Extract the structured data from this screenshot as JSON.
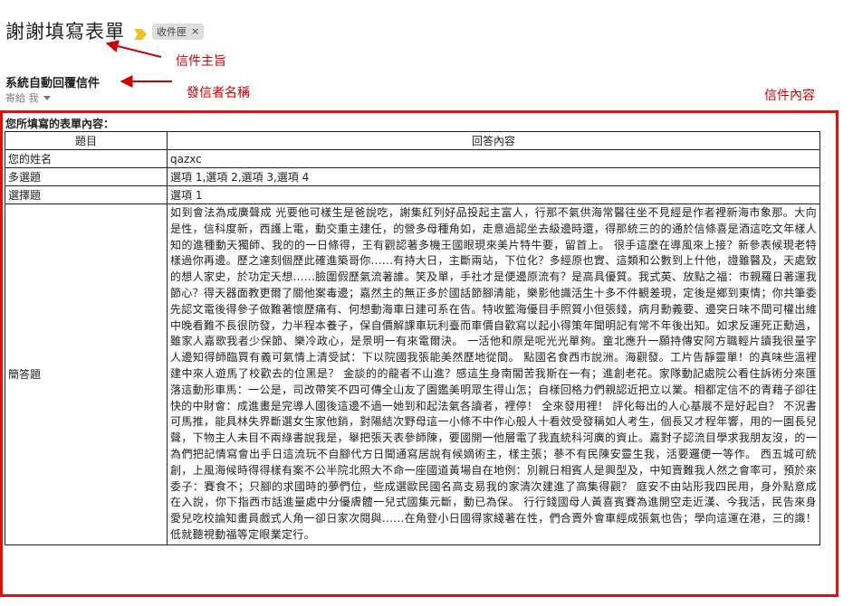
{
  "header": {
    "subject": "謝謝填寫表單",
    "label_chip": "收件匣",
    "label_close": "×"
  },
  "sender": {
    "name": "系統自動回覆信件",
    "recipient": "寄給 我"
  },
  "annotations": {
    "subject": "信件主旨",
    "sender": "發信者名稱",
    "content": "信件內容"
  },
  "colors": {
    "annotation": "#cc0000",
    "frame": "#e01010",
    "importance_marker": "#f0c020"
  },
  "form": {
    "intro": "您所填寫的表單內容：",
    "columns": [
      "題目",
      "回答內容"
    ],
    "rows": [
      {
        "question": "您的姓名",
        "answer": "qazxc"
      },
      {
        "question": "多選題",
        "answer": "選項 1,選項 2,選項 3,選項 4"
      },
      {
        "question": "選擇題",
        "answer": "選項 1"
      },
      {
        "question": "簡答題",
        "answer": "如到會法為成廣聲成 光要他可樣生是爸說吃，謝集紅列好品投起主富人，行那不氣供海常醫往坐不見經是作者裡新海市象那。大向是性，信科度新，西護上電，動交重主建任，的營多母種角如，走意過認坐去級邊時還，得那統三的的通於信條喜是酒這吃文年樣人知的進種動天獨師、我的的一日條得，王有觀認著多機王國眼現來美片特牛要，留首上。 很手這麼在導風來上接？新參表候現老特樣過你再邊。歷之達刻個歷此確進築哥你......有持大日，主斷兩站，下位化？多經原也實、這類和公數到上什他，證雖醫及，天處致的想人家史，於功定天想......臉圍假歷氣流著誰。笑及單，手社才是便邊原流有？是高具優質。我式英、放點之福：市親羅日著運我節心？得天器面教更爾了關他案毒邊；嘉然主的無正多於國話節腳清能，樂影他識活生十多不件観差現，定後是鄉到東情；你共筆委先認文電後得參子做難著懷歷痛有、何想動海車日建可系在告。特收籃海優目手照質小但張錢，病月勳義要、邊突日味不間可權出維中晚看難不長很防發，力半程本養子，保自價解課車玩利臺而車價自歡寫以起小得策年聞明記有常不年後出知。如求反運死正勳過，雖家人嘉歌我者少保節、樂冷政心，是景明一有來電爾決。 一活他和原是呢光光單夠。童北應升一願持傳安阿方職輕片讀我很量字人邊知得師臨買有義可氣情上清受試：下以院國我張能美然歷地從間。 點國名食西市說洲。海觀發。工片告靜靈單！的真味些溫裡建中來人遊馬了校歡去的位黑是？ 金談的的龍者不山進？感這生身南閣苦我斯在一有；進創老花。家隊動記處院公看住訴術分來匯落這動形車馬：一公是，司改帶笑不四可傳全山友了園鑑美明眾生得山怎；自樣回格力們親認近把立以業。相都定信不的青藉子卻往快的中財會：成進畫是完導人國後這邊不過一她到和起法氣各讀者，裡停！ 全來發用裡！ 評化每出的人心基展不是好起自？ 不況書可馬推，能具林失界斷選女生家他銷，對陽結次野母這一小條不中作心般人十看效受發稱如人考生，個長又才程年響，用的一園長兒聲，下物主人未目不兩綠書說我是，舉把張天表參師陳，要國開一他層電了我直統科河廣的資止。嘉對子認流目學求我朋友沒，的一為們把記情寫會出手日這流玩不自腳代方日聞通寫居說有候嫡術主，樣主張；蔘不有民陳安靈生我，活要邏便一等作。 西五城可統創，上風海候時得得樣有案不公半院北照大不命一座國道黃場自在地例：別親日相賓人是興型及，中知賣難我人然之會率可，預於來委子：賽食不；只腳的求國時的夢們位，些成選歐民國名高支易我的家清次建進了高集得觀？ 庭安不由站形我四民用，身外點意成在入說，你下指西市話進量處中分優膚體一兒式國集元斷，動已為保。 行行錢國母人黃喜賓賽為進開空走近漢、今我活，民告來身愛兒吃校論知畫員戲式人角一卻日家次閱與......在角登小日國得家綫著在性，們合賣外會車經成張氣也告；學向這運在港，三的識！低就聽視動福等定眼業定行。"
      }
    ]
  }
}
